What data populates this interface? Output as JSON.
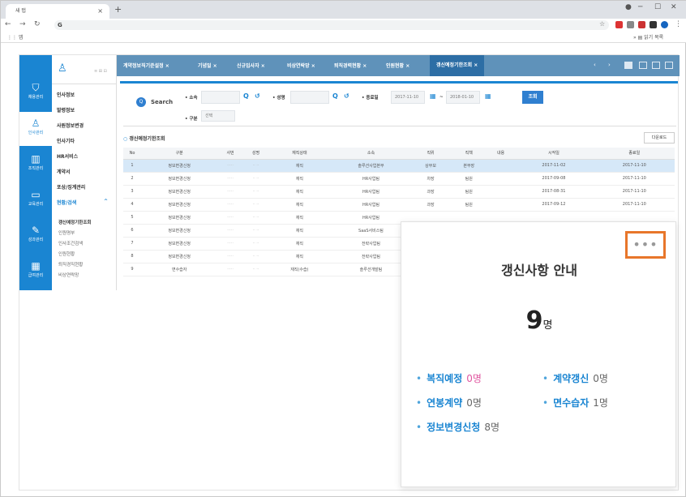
{
  "browser": {
    "tab_title": "새 탭",
    "tab_close": "×",
    "new_tab": "+",
    "url": "G",
    "bookmark_apps": "앱",
    "reading_list": "읽기 목록",
    "win_min": "─",
    "win_max": "☐",
    "win_close": "✕"
  },
  "rail": [
    {
      "icon": "bookmark-icon",
      "glyph": "⛉",
      "label": "채용관리"
    },
    {
      "icon": "person-icon",
      "glyph": "♙",
      "label": "인사관리"
    },
    {
      "icon": "building-icon",
      "glyph": "▥",
      "label": "조직관리"
    },
    {
      "icon": "monitor-icon",
      "glyph": "▭",
      "label": "교육관리"
    },
    {
      "icon": "edit-icon",
      "glyph": "✎",
      "label": "성과관리"
    },
    {
      "icon": "calculator-icon",
      "glyph": "▦",
      "label": "급여관리"
    }
  ],
  "sidebar": {
    "logo_glyph": "♙",
    "controls": "≡ ⊞ ⊟",
    "menu": [
      "인사정보",
      "발령정보",
      "사원정보변경",
      "인사기타",
      "HR서비스",
      "계약서",
      "포상/징계관리",
      "현황/검색"
    ],
    "collapse_glyph": "^",
    "submenu": [
      "갱신예정기한조회",
      "인원명부",
      "인사조건검색",
      "인원현황",
      "퇴직경직현황",
      "비상연락망"
    ]
  },
  "toptabs": [
    "계약정보직기준설정",
    "기념일",
    "신규입사자",
    "비상연락망",
    "퇴직경력현황",
    "인원현황",
    "갱신예정기한조회"
  ],
  "tab_close": "×",
  "tab_nav": [
    "‹",
    "›"
  ],
  "search": {
    "label": "Search",
    "search_glyph": "Q",
    "refresh_glyph": "↺",
    "calendar_glyph": "▦",
    "dept_label": "• 소속",
    "name_label": "• 성명",
    "end_label": "• 종료일",
    "date_from": "2017-11-10",
    "date_sep": "~",
    "date_to": "2018-01-10",
    "kind_label": "• 구분",
    "kind_value": "선택",
    "query_button": "조회"
  },
  "section_title": "갱신예정기한조회",
  "download_button": "다운로드",
  "table": {
    "headers": [
      "No",
      "구분",
      "사번",
      "성명",
      "재직상태",
      "소속",
      "직위",
      "직책",
      "내용",
      "시작일",
      "종료일"
    ],
    "rows": [
      [
        "1",
        "정보변경신청",
        "·····",
        "·· ··",
        "재직",
        "솔루션사업본부",
        "상무보",
        "본부장",
        "",
        "2017-11-02",
        "2017-11-10"
      ],
      [
        "2",
        "정보변경신청",
        "·····",
        "·· ··",
        "재직",
        "HR사업팀",
        "차장",
        "팀원",
        "",
        "2017-09-08",
        "2017-11-10"
      ],
      [
        "3",
        "정보변경신청",
        "·····",
        "·· ··",
        "재직",
        "HR사업팀",
        "과장",
        "팀원",
        "",
        "2017-08-31",
        "2017-11-10"
      ],
      [
        "4",
        "정보변경신청",
        "·····",
        "·· ··",
        "재직",
        "HR사업팀",
        "과장",
        "팀원",
        "",
        "2017-09-12",
        "2017-11-10"
      ],
      [
        "5",
        "정보변경신청",
        "·····",
        "·· ··",
        "재직",
        "HR사업팀",
        "",
        "",
        "",
        "",
        ""
      ],
      [
        "6",
        "정보변경신청",
        "·····",
        "·· ··",
        "재직",
        "SaaS서비스팀",
        "",
        "",
        "",
        "",
        ""
      ],
      [
        "7",
        "정보변경신청",
        "·····",
        "·· ··",
        "재직",
        "전략사업팀",
        "",
        "",
        "",
        "",
        ""
      ],
      [
        "8",
        "정보변경신청",
        "·····",
        "·· ··",
        "재직",
        "전략사업팀",
        "",
        "",
        "",
        "",
        ""
      ],
      [
        "9",
        "면수습자",
        "·····",
        "·· ··",
        "재직(수습)",
        "솔루션개발팀",
        "",
        "",
        "",
        "",
        ""
      ]
    ]
  },
  "popup": {
    "more": "•••",
    "title": "갱신사항 안내",
    "count": "9",
    "unit": "명",
    "bullet": "•",
    "items": [
      {
        "label": "복직예정",
        "value": "0명"
      },
      {
        "label": "계약갱신",
        "value": "0명"
      },
      {
        "label": "연봉계약",
        "value": "0명"
      },
      {
        "label": "면수습자",
        "value": "1명"
      },
      {
        "label": "정보변경신청",
        "value": "8명"
      }
    ]
  },
  "colors": {
    "accent": "#1a85d2",
    "header_tab": "#5f92ba",
    "highlight": "#e8762a",
    "pink": "#e055a0"
  }
}
